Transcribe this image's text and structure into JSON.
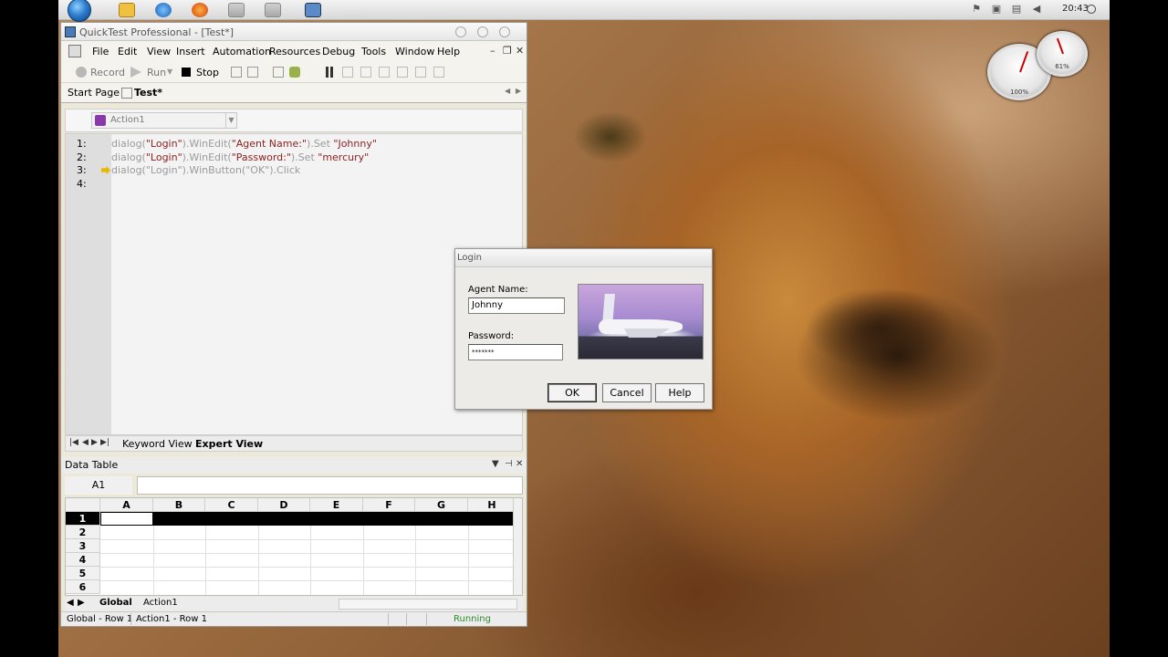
{
  "taskbar": {
    "clock": "20:43"
  },
  "gadget": {
    "cpu_value": "100%",
    "ram_value": "61%"
  },
  "qtp": {
    "title": "QuickTest Professional - [Test*]",
    "menu": [
      "File",
      "Edit",
      "View",
      "Insert",
      "Automation",
      "Resources",
      "Debug",
      "Tools",
      "Window",
      "Help"
    ],
    "toolbar": {
      "record": "Record",
      "run": "Run",
      "stop": "Stop"
    },
    "tabs": {
      "start_page": "Start Page",
      "test": "Test*"
    },
    "action_combo": "Action1",
    "code_lines": [
      {
        "num": "1:",
        "a": "dialog(",
        "s1": "\"Login\"",
        "b": ").WinEdit(",
        "s2": "\"Agent Name:\"",
        "c": ").Set ",
        "s3": "\"Johnny\""
      },
      {
        "num": "2:",
        "a": "dialog(",
        "s1": "\"Login\"",
        "b": ").WinEdit(",
        "s2": "\"Password:\"",
        "c": ").Set ",
        "s3": "\"mercury\""
      },
      {
        "num": "3:",
        "a": "dialog(",
        "s1": "\"Login\"",
        "b": ").WinButton(",
        "s2": "\"OK\"",
        "c": ").Click",
        "s3": ""
      },
      {
        "num": "4:",
        "a": "",
        "s1": "",
        "b": "",
        "s2": "",
        "c": "",
        "s3": ""
      }
    ],
    "view_tabs": {
      "keyword": "Keyword View",
      "expert": "Expert View"
    },
    "data_table": {
      "title": "Data Table",
      "cell_ref": "A1",
      "columns": [
        "A",
        "B",
        "C",
        "D",
        "E",
        "F",
        "G",
        "H"
      ],
      "rows": [
        "1",
        "2",
        "3",
        "4",
        "5",
        "6"
      ],
      "sheets": [
        "Global",
        "Action1"
      ]
    },
    "status": {
      "global_row": "Global - Row 1",
      "action_row": "Action1 - Row 1",
      "state": "Running"
    }
  },
  "login": {
    "title": "Login",
    "agent_label": "Agent Name:",
    "agent_value": "Johnny",
    "password_label": "Password:",
    "password_value": "*******",
    "ok": "OK",
    "cancel": "Cancel",
    "help": "Help"
  }
}
